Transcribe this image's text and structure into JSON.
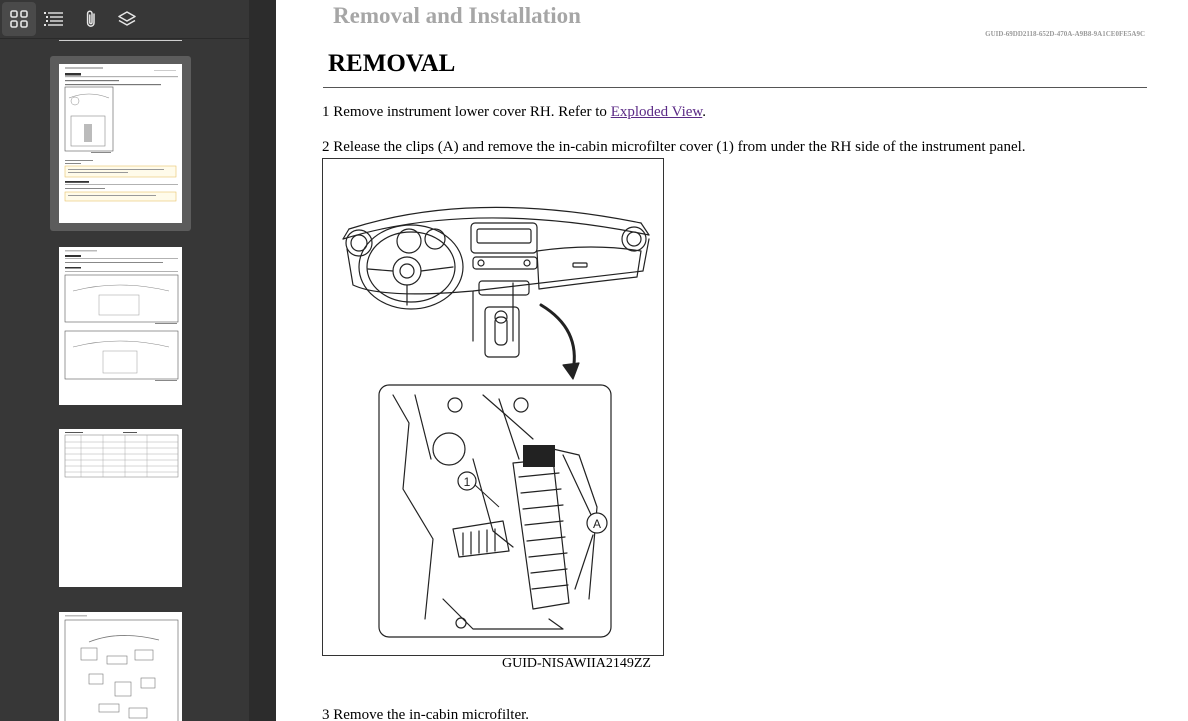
{
  "toolbar": {
    "buttons": [
      {
        "icon": "thumbnails-grid-icon",
        "active": true
      },
      {
        "icon": "outline-list-icon",
        "active": false
      },
      {
        "icon": "paperclip-icon",
        "active": false
      },
      {
        "icon": "layers-icon",
        "active": false
      }
    ]
  },
  "thumbnails": [
    {
      "page": 1,
      "selected": true
    },
    {
      "page": 2,
      "selected": false
    },
    {
      "page": 3,
      "selected": false
    },
    {
      "page": 4,
      "selected": false
    }
  ],
  "document": {
    "heading": "Removal and Installation",
    "guid": "GUID-69DD2118-652D-470A-A9B8-9A1CE0FE5A9C",
    "section_title": "REMOVAL",
    "steps": [
      {
        "number": "1",
        "text_before": "Remove instrument lower cover RH. Refer to ",
        "link": "Exploded View",
        "text_after": "."
      },
      {
        "number": "2",
        "text": "Release the clips (A) and remove the in-cabin microfilter cover (1) from under the RH side of the instrument panel."
      },
      {
        "number": "3",
        "text": "Remove the in-cabin microfilter."
      }
    ],
    "figure": {
      "caption": "GUID-NISAWIIA2149ZZ",
      "callouts": [
        "1",
        "A"
      ]
    }
  },
  "colors": {
    "sidebar_bg": "#373737",
    "link": "#5b2a86",
    "heading_gray": "#a6a6a6"
  }
}
